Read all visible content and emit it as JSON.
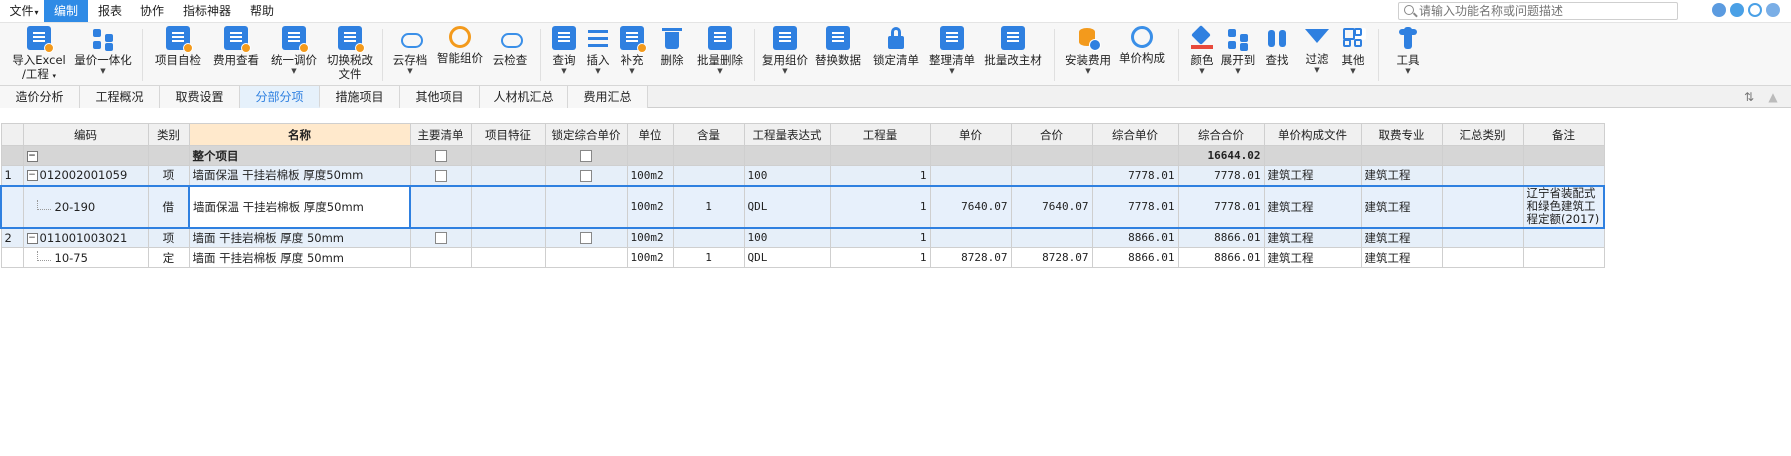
{
  "menu": {
    "items": [
      {
        "label": "文件",
        "has_caret": true
      },
      {
        "label": "编制",
        "active": true
      },
      {
        "label": "报表"
      },
      {
        "label": "协作"
      },
      {
        "label": "指标神器"
      },
      {
        "label": "帮助"
      }
    ],
    "search_placeholder": "请输入功能名称或问题描述"
  },
  "ribbon": {
    "buttons": [
      {
        "line1": "导入Excel",
        "line2": "/工程",
        "dropdown": true,
        "icon": "import-excel-icon"
      },
      {
        "line1": "量价一体化",
        "dropdown": true,
        "icon": "integration-icon"
      },
      {
        "line1": "项目自检",
        "icon": "self-check-icon"
      },
      {
        "line1": "费用查看",
        "icon": "cost-view-icon"
      },
      {
        "line1": "统一调价",
        "dropdown": true,
        "icon": "unify-price-icon"
      },
      {
        "line1": "切换税改",
        "line2": "文件",
        "icon": "tax-switch-icon"
      },
      {
        "line1": "云存档",
        "dropdown": true,
        "icon": "cloud-save-icon"
      },
      {
        "line1": "智能组价",
        "icon": "smart-price-icon"
      },
      {
        "line1": "云检查",
        "icon": "cloud-check-icon"
      },
      {
        "line1": "查询",
        "dropdown": true,
        "icon": "query-icon"
      },
      {
        "line1": "插入",
        "dropdown": true,
        "icon": "insert-icon"
      },
      {
        "line1": "补充",
        "dropdown": true,
        "icon": "supplement-icon"
      },
      {
        "line1": "删除",
        "icon": "delete-icon"
      },
      {
        "line1": "批量删除",
        "dropdown": true,
        "icon": "batch-delete-icon"
      },
      {
        "line1": "复用组价",
        "dropdown": true,
        "icon": "reuse-price-icon"
      },
      {
        "line1": "替换数据",
        "icon": "replace-data-icon"
      },
      {
        "line1": "锁定清单",
        "icon": "lock-list-icon"
      },
      {
        "line1": "整理清单",
        "dropdown": true,
        "icon": "organize-list-icon"
      },
      {
        "line1": "批量改主材",
        "icon": "batch-material-icon"
      },
      {
        "line1": "安装费用",
        "dropdown": true,
        "icon": "install-cost-icon"
      },
      {
        "line1": "单价构成",
        "icon": "unit-price-icon"
      },
      {
        "line1": "颜色",
        "dropdown": true,
        "icon": "color-icon"
      },
      {
        "line1": "展开到",
        "dropdown": true,
        "icon": "expand-icon"
      },
      {
        "line1": "查找",
        "icon": "find-icon"
      },
      {
        "line1": "过滤",
        "dropdown": true,
        "icon": "filter-icon"
      },
      {
        "line1": "其他",
        "dropdown": true,
        "icon": "other-icon"
      },
      {
        "line1": "工具",
        "dropdown": true,
        "icon": "tools-icon"
      }
    ]
  },
  "tabs": [
    {
      "label": "造价分析"
    },
    {
      "label": "工程概况"
    },
    {
      "label": "取费设置"
    },
    {
      "label": "分部分项",
      "active": true
    },
    {
      "label": "措施项目"
    },
    {
      "label": "其他项目"
    },
    {
      "label": "人材机汇总"
    },
    {
      "label": "费用汇总"
    }
  ],
  "table": {
    "headers": [
      "",
      "编码",
      "类别",
      "名称",
      "主要清单",
      "项目特征",
      "锁定综合单价",
      "单位",
      "含量",
      "工程量表达式",
      "工程量",
      "单价",
      "合价",
      "综合单价",
      "综合合价",
      "单价构成文件",
      "取费专业",
      "汇总类别",
      "备注"
    ],
    "rows": [
      {
        "kind": "total",
        "no": "",
        "code": "",
        "cat": "",
        "name": "整个项目",
        "main": "cb",
        "feat": "",
        "lock": "cb",
        "unit": "",
        "qty_ratio": "",
        "expr": "",
        "qty": "",
        "price": "",
        "amount": "",
        "unit_total": "",
        "total": "16644.02",
        "file": "",
        "major": "",
        "sum_cat": "",
        "note": "",
        "toggle": "−"
      },
      {
        "kind": "lvl1",
        "no": "1",
        "code": "012002001059",
        "cat": "项",
        "name": "墙面保温 干挂岩棉板 厚度50mm",
        "main": "cb",
        "feat": "",
        "lock": "cb",
        "unit": "100m2",
        "qty_ratio": "",
        "expr": "100",
        "qty": "1",
        "price": "",
        "amount": "",
        "unit_total": "7778.01",
        "total": "7778.01",
        "file": "建筑工程",
        "major": "建筑工程",
        "sum_cat": "",
        "note": "",
        "toggle": "−"
      },
      {
        "kind": "sel",
        "no": "",
        "code": "20-190",
        "cat": "借",
        "name": "墙面保温 干挂岩棉板 厚度50mm",
        "main": "",
        "feat": "",
        "lock": "",
        "unit": "100m2",
        "qty_ratio": "1",
        "expr": "QDL",
        "qty": "1",
        "price": "7640.07",
        "amount": "7640.07",
        "unit_total": "7778.01",
        "total": "7778.01",
        "file": "建筑工程",
        "major": "建筑工程",
        "sum_cat": "",
        "note": "辽宁省装配式和绿色建筑工程定额(2017)"
      },
      {
        "kind": "lvl1",
        "no": "2",
        "code": "011001003021",
        "cat": "项",
        "name": "墙面 干挂岩棉板 厚度 50mm",
        "main": "cb",
        "feat": "",
        "lock": "cb",
        "unit": "100m2",
        "qty_ratio": "",
        "expr": "100",
        "qty": "1",
        "price": "",
        "amount": "",
        "unit_total": "8866.01",
        "total": "8866.01",
        "file": "建筑工程",
        "major": "建筑工程",
        "sum_cat": "",
        "note": "",
        "toggle": "−"
      },
      {
        "kind": "plain",
        "no": "",
        "code": "10-75",
        "cat": "定",
        "name": "墙面 干挂岩棉板 厚度 50mm",
        "main": "",
        "feat": "",
        "lock": "",
        "unit": "100m2",
        "qty_ratio": "1",
        "expr": "QDL",
        "qty": "1",
        "price": "8728.07",
        "amount": "8728.07",
        "unit_total": "8866.01",
        "total": "8866.01",
        "file": "建筑工程",
        "major": "建筑工程",
        "sum_cat": "",
        "note": ""
      }
    ]
  },
  "colors": {
    "accent": "#2f80e0",
    "active_tab_bg": "#e6f1fb",
    "total_row_bg": "#d6d6d6",
    "name_header_bg": "#ffe9cc"
  }
}
